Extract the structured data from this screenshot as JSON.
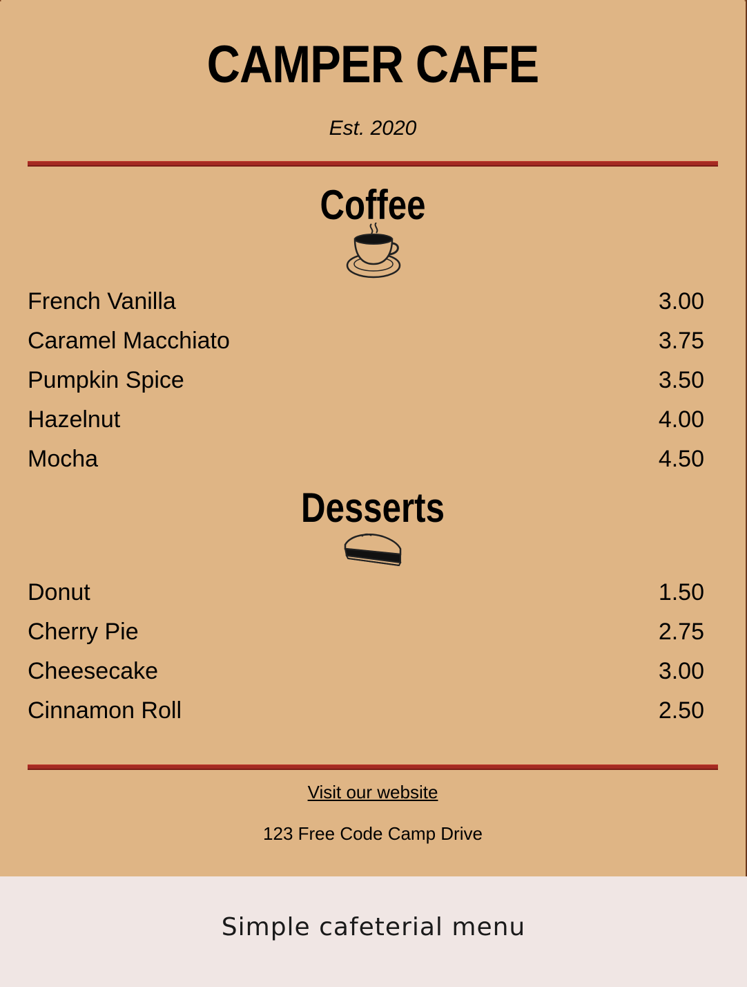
{
  "menu": {
    "title": "CAMPER CAFE",
    "established": "Est. 2020",
    "sections": [
      {
        "title": "Coffee",
        "icon": "coffee-cup-icon",
        "items": [
          {
            "name": "French Vanilla",
            "price": "3.00"
          },
          {
            "name": "Caramel Macchiato",
            "price": "3.75"
          },
          {
            "name": "Pumpkin Spice",
            "price": "3.50"
          },
          {
            "name": "Hazelnut",
            "price": "4.00"
          },
          {
            "name": "Mocha",
            "price": "4.50"
          }
        ]
      },
      {
        "title": "Desserts",
        "icon": "pie-slice-icon",
        "items": [
          {
            "name": "Donut",
            "price": "1.50"
          },
          {
            "name": "Cherry Pie",
            "price": "2.75"
          },
          {
            "name": "Cheesecake",
            "price": "3.00"
          },
          {
            "name": "Cinnamon Roll",
            "price": "2.50"
          }
        ]
      }
    ],
    "footer": {
      "link_text": "Visit our website",
      "address": "123 Free Code Camp Drive"
    }
  },
  "caption": "Simple cafeterial menu",
  "colors": {
    "menu_background": "#dfb585",
    "rule": "#a52a22",
    "page_background": "#f0e6e4"
  }
}
